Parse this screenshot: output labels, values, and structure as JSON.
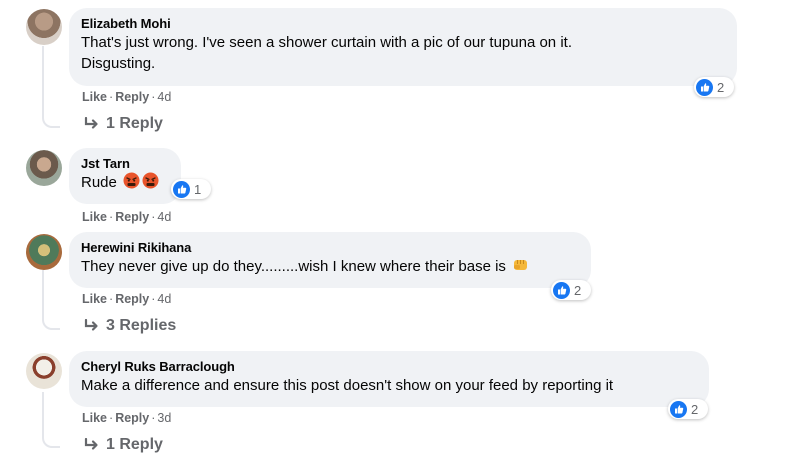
{
  "comments": [
    {
      "author": "Elizabeth Mohi",
      "text_line1": "That's just wrong. I've seen a shower curtain with a pic of our tupuna on it.",
      "text_line2": "Disgusting.",
      "like_label": "Like",
      "reply_label": "Reply",
      "time": "4d",
      "reaction_count": "2",
      "replies_label": "1 Reply"
    },
    {
      "author": "Jst Tarn",
      "text": "Rude",
      "emoji_icons": [
        "angry-face-icon",
        "angry-face-icon"
      ],
      "like_label": "Like",
      "reply_label": "Reply",
      "time": "4d",
      "reaction_count": "1"
    },
    {
      "author": "Herewini Rikihana",
      "text": "They never give up do they.........wish I knew where their base is",
      "emoji_icons": [
        "fist-icon"
      ],
      "like_label": "Like",
      "reply_label": "Reply",
      "time": "4d",
      "reaction_count": "2",
      "replies_label": "3 Replies"
    },
    {
      "author": "Cheryl Ruks Barraclough",
      "text": "Make a difference and ensure this post doesn't show on your feed by reporting it",
      "like_label": "Like",
      "reply_label": "Reply",
      "time": "3d",
      "reaction_count": "2",
      "replies_label": "1 Reply"
    }
  ],
  "colors": {
    "bubble": "#f0f2f5",
    "secondary_text": "#65676b",
    "like_blue": "#1877f2",
    "thread_line": "#e4e6eb"
  }
}
